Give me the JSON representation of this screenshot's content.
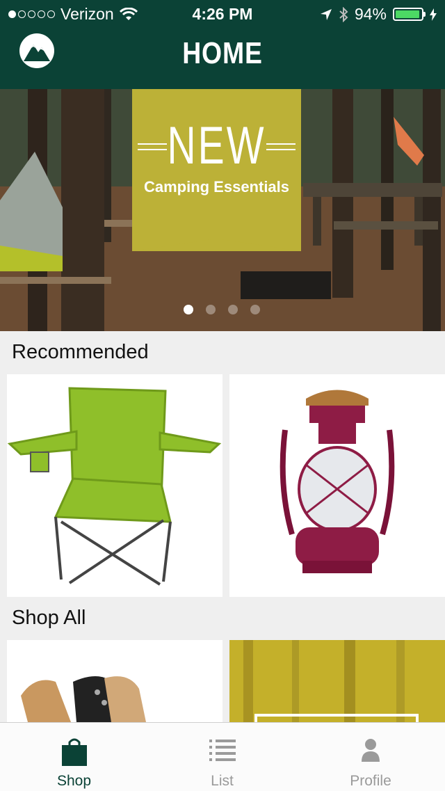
{
  "status_bar": {
    "carrier": "Verizon",
    "signal_dots": [
      true,
      false,
      false,
      false,
      false
    ],
    "time": "4:26 PM",
    "battery": "94%",
    "battery_level": 0.94
  },
  "header": {
    "title": "HOME",
    "logo_icon": "mountain-logo-icon"
  },
  "hero": {
    "banner_title": "NEW",
    "banner_subtitle": "Camping Essentials",
    "banner_color": "#bcb137",
    "page_count": 4,
    "active_page": 1
  },
  "recommended": {
    "title": "Recommended",
    "items": [
      {
        "icon": "camping-chair-icon"
      },
      {
        "icon": "lantern-icon"
      }
    ]
  },
  "shop_all": {
    "title": "Shop All",
    "items": [
      {
        "icon": "boots-icon"
      },
      {
        "icon": "forest-category-icon"
      }
    ]
  },
  "tabbar": {
    "tabs": [
      {
        "label": "Shop",
        "icon": "shopping-bag-icon",
        "active": true
      },
      {
        "label": "List",
        "icon": "list-icon",
        "active": false
      },
      {
        "label": "Profile",
        "icon": "person-icon",
        "active": false
      }
    ]
  },
  "colors": {
    "brand": "#0b4236",
    "background": "#efefef",
    "battery": "#4cd964"
  }
}
